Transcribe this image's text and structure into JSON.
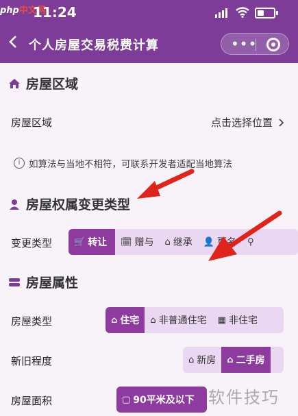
{
  "status_bar": {
    "time": "11:24",
    "watermark_logo": "php中文网"
  },
  "navbar": {
    "back_icon": "chevron-left-icon",
    "title": "个人房屋交易税费计算",
    "capsule_more": "•••"
  },
  "section_area": {
    "title": "房屋区域",
    "row_label": "房屋区域",
    "row_value": "点击选择位置",
    "note": "如算法与当地不相符，可联系开发者适配当地算法"
  },
  "section_ownership": {
    "title": "房屋权属变更类型",
    "row_label": "变更类型",
    "options": [
      "转让",
      "赠与",
      "继承",
      "更名",
      ""
    ],
    "selected": "转让"
  },
  "section_property": {
    "title": "房屋属性",
    "type_label": "房屋类型",
    "type_options": [
      "住宅",
      "非普通住宅",
      "非住宅"
    ],
    "type_selected": "住宅",
    "age_label": "新旧程度",
    "age_options": [
      "新房",
      "二手房"
    ],
    "age_selected": "二手房",
    "area_label": "房屋面积",
    "area_options": [
      "90平米及以下"
    ],
    "area_selected": "90平米及以下"
  },
  "watermark": "软件技巧",
  "colors": {
    "primary": "#7d3c98",
    "active": "#8e3ba0",
    "light": "#ead7f1",
    "arrow": "#e0241b"
  }
}
